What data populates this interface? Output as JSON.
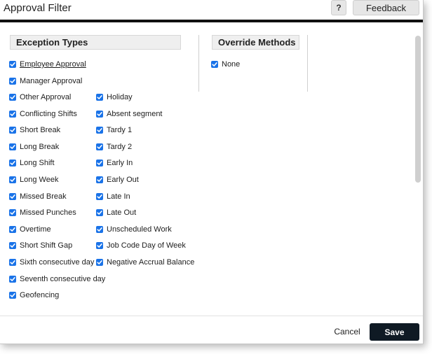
{
  "dialog": {
    "title": "Approval Filter",
    "help_label": "?",
    "feedback_label": "Feedback"
  },
  "exception_types": {
    "heading": "Exception Types",
    "single_items": [
      {
        "label": "Employee Approval",
        "checked": true
      },
      {
        "label": "Manager Approval",
        "checked": true
      }
    ],
    "left_column": [
      {
        "label": "Other Approval",
        "checked": true
      },
      {
        "label": "Conflicting Shifts",
        "checked": true
      },
      {
        "label": "Short Break",
        "checked": true
      },
      {
        "label": "Long Break",
        "checked": true
      },
      {
        "label": "Long Shift",
        "checked": true
      },
      {
        "label": "Long Week",
        "checked": true
      },
      {
        "label": "Missed Break",
        "checked": true
      },
      {
        "label": "Missed Punches",
        "checked": true
      },
      {
        "label": "Overtime",
        "checked": true
      },
      {
        "label": "Short Shift Gap",
        "checked": true
      },
      {
        "label": "Sixth consecutive day",
        "checked": true
      },
      {
        "label": "Seventh consecutive day",
        "checked": true
      },
      {
        "label": "Geofencing",
        "checked": true
      }
    ],
    "right_column": [
      {
        "label": "Holiday",
        "checked": true
      },
      {
        "label": "Absent segment",
        "checked": true
      },
      {
        "label": "Tardy 1",
        "checked": true
      },
      {
        "label": "Tardy 2",
        "checked": true
      },
      {
        "label": "Early In",
        "checked": true
      },
      {
        "label": "Early Out",
        "checked": true
      },
      {
        "label": "Late In",
        "checked": true
      },
      {
        "label": "Late Out",
        "checked": true
      },
      {
        "label": "Unscheduled Work",
        "checked": true
      },
      {
        "label": "Job Code Day of Week",
        "checked": true
      },
      {
        "label": "Negative Accrual Balance",
        "checked": true
      }
    ]
  },
  "override_methods": {
    "heading": "Override Methods",
    "items": [
      {
        "label": "None",
        "checked": true
      }
    ]
  },
  "footer": {
    "cancel_label": "Cancel",
    "save_label": "Save"
  },
  "colors": {
    "checkbox": "#1a73e8",
    "save_button": "#0f1a24",
    "header_bar": "#111111"
  }
}
